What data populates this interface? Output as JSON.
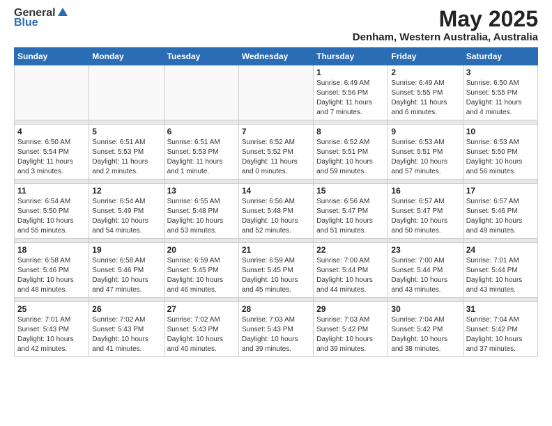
{
  "header": {
    "logo_general": "General",
    "logo_blue": "Blue",
    "month_title": "May 2025",
    "location": "Denham, Western Australia, Australia"
  },
  "weekdays": [
    "Sunday",
    "Monday",
    "Tuesday",
    "Wednesday",
    "Thursday",
    "Friday",
    "Saturday"
  ],
  "weeks": [
    [
      {
        "day": "",
        "info": ""
      },
      {
        "day": "",
        "info": ""
      },
      {
        "day": "",
        "info": ""
      },
      {
        "day": "",
        "info": ""
      },
      {
        "day": "1",
        "info": "Sunrise: 6:49 AM\nSunset: 5:56 PM\nDaylight: 11 hours\nand 7 minutes."
      },
      {
        "day": "2",
        "info": "Sunrise: 6:49 AM\nSunset: 5:55 PM\nDaylight: 11 hours\nand 6 minutes."
      },
      {
        "day": "3",
        "info": "Sunrise: 6:50 AM\nSunset: 5:55 PM\nDaylight: 11 hours\nand 4 minutes."
      }
    ],
    [
      {
        "day": "4",
        "info": "Sunrise: 6:50 AM\nSunset: 5:54 PM\nDaylight: 11 hours\nand 3 minutes."
      },
      {
        "day": "5",
        "info": "Sunrise: 6:51 AM\nSunset: 5:53 PM\nDaylight: 11 hours\nand 2 minutes."
      },
      {
        "day": "6",
        "info": "Sunrise: 6:51 AM\nSunset: 5:53 PM\nDaylight: 11 hours\nand 1 minute."
      },
      {
        "day": "7",
        "info": "Sunrise: 6:52 AM\nSunset: 5:52 PM\nDaylight: 11 hours\nand 0 minutes."
      },
      {
        "day": "8",
        "info": "Sunrise: 6:52 AM\nSunset: 5:51 PM\nDaylight: 10 hours\nand 59 minutes."
      },
      {
        "day": "9",
        "info": "Sunrise: 6:53 AM\nSunset: 5:51 PM\nDaylight: 10 hours\nand 57 minutes."
      },
      {
        "day": "10",
        "info": "Sunrise: 6:53 AM\nSunset: 5:50 PM\nDaylight: 10 hours\nand 56 minutes."
      }
    ],
    [
      {
        "day": "11",
        "info": "Sunrise: 6:54 AM\nSunset: 5:50 PM\nDaylight: 10 hours\nand 55 minutes."
      },
      {
        "day": "12",
        "info": "Sunrise: 6:54 AM\nSunset: 5:49 PM\nDaylight: 10 hours\nand 54 minutes."
      },
      {
        "day": "13",
        "info": "Sunrise: 6:55 AM\nSunset: 5:48 PM\nDaylight: 10 hours\nand 53 minutes."
      },
      {
        "day": "14",
        "info": "Sunrise: 6:56 AM\nSunset: 5:48 PM\nDaylight: 10 hours\nand 52 minutes."
      },
      {
        "day": "15",
        "info": "Sunrise: 6:56 AM\nSunset: 5:47 PM\nDaylight: 10 hours\nand 51 minutes."
      },
      {
        "day": "16",
        "info": "Sunrise: 6:57 AM\nSunset: 5:47 PM\nDaylight: 10 hours\nand 50 minutes."
      },
      {
        "day": "17",
        "info": "Sunrise: 6:57 AM\nSunset: 5:46 PM\nDaylight: 10 hours\nand 49 minutes."
      }
    ],
    [
      {
        "day": "18",
        "info": "Sunrise: 6:58 AM\nSunset: 5:46 PM\nDaylight: 10 hours\nand 48 minutes."
      },
      {
        "day": "19",
        "info": "Sunrise: 6:58 AM\nSunset: 5:46 PM\nDaylight: 10 hours\nand 47 minutes."
      },
      {
        "day": "20",
        "info": "Sunrise: 6:59 AM\nSunset: 5:45 PM\nDaylight: 10 hours\nand 46 minutes."
      },
      {
        "day": "21",
        "info": "Sunrise: 6:59 AM\nSunset: 5:45 PM\nDaylight: 10 hours\nand 45 minutes."
      },
      {
        "day": "22",
        "info": "Sunrise: 7:00 AM\nSunset: 5:44 PM\nDaylight: 10 hours\nand 44 minutes."
      },
      {
        "day": "23",
        "info": "Sunrise: 7:00 AM\nSunset: 5:44 PM\nDaylight: 10 hours\nand 43 minutes."
      },
      {
        "day": "24",
        "info": "Sunrise: 7:01 AM\nSunset: 5:44 PM\nDaylight: 10 hours\nand 43 minutes."
      }
    ],
    [
      {
        "day": "25",
        "info": "Sunrise: 7:01 AM\nSunset: 5:43 PM\nDaylight: 10 hours\nand 42 minutes."
      },
      {
        "day": "26",
        "info": "Sunrise: 7:02 AM\nSunset: 5:43 PM\nDaylight: 10 hours\nand 41 minutes."
      },
      {
        "day": "27",
        "info": "Sunrise: 7:02 AM\nSunset: 5:43 PM\nDaylight: 10 hours\nand 40 minutes."
      },
      {
        "day": "28",
        "info": "Sunrise: 7:03 AM\nSunset: 5:43 PM\nDaylight: 10 hours\nand 39 minutes."
      },
      {
        "day": "29",
        "info": "Sunrise: 7:03 AM\nSunset: 5:42 PM\nDaylight: 10 hours\nand 39 minutes."
      },
      {
        "day": "30",
        "info": "Sunrise: 7:04 AM\nSunset: 5:42 PM\nDaylight: 10 hours\nand 38 minutes."
      },
      {
        "day": "31",
        "info": "Sunrise: 7:04 AM\nSunset: 5:42 PM\nDaylight: 10 hours\nand 37 minutes."
      }
    ]
  ]
}
